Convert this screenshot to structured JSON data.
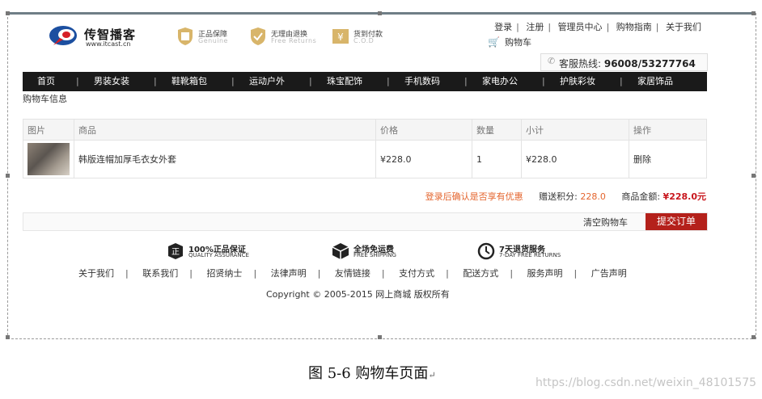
{
  "header": {
    "logo_name": "传智播客",
    "logo_url": "www.itcast.cn",
    "badges": [
      {
        "title": "正品保障",
        "subtitle": "Genuine"
      },
      {
        "title": "无理由退换",
        "subtitle": "Free Returns"
      },
      {
        "title": "货到付款",
        "subtitle": "C.O.D"
      }
    ],
    "top_links": [
      "登录",
      "注册",
      "管理员中心",
      "购物指南",
      "关于我们"
    ],
    "cart_label": "购物车",
    "hotline_label": "客服热线: ",
    "hotline_number": "96008/53277764"
  },
  "nav": {
    "items": [
      "首页",
      "男装女装",
      "鞋靴箱包",
      "运动户外",
      "珠宝配饰",
      "手机数码",
      "家电办公",
      "护肤彩妆",
      "家居饰品"
    ]
  },
  "cart": {
    "section_title": "购物车信息",
    "columns": [
      "图片",
      "商品",
      "价格",
      "数量",
      "小计",
      "操作"
    ],
    "rows": [
      {
        "name": "韩版连帽加厚毛衣女外套",
        "price": "¥228.0",
        "quantity": "1",
        "subtotal": "¥228.0",
        "action": "删除"
      }
    ],
    "promo_text": "登录后确认是否享有优惠",
    "points_label": "赠送积分: ",
    "points_value": "228.0",
    "amount_label": "商品金额: ",
    "amount_value": "¥228.0元",
    "clear_label": "清空购物车",
    "submit_label": "提交订单"
  },
  "footer": {
    "guarantees": [
      {
        "title": "100%正品保证",
        "subtitle": "QUALITY ASSURANCE",
        "icon": "quality-icon"
      },
      {
        "title": "全场免运费",
        "subtitle": "FREE SHIPPING",
        "icon": "box-icon"
      },
      {
        "title": "7天退货服务",
        "subtitle": "7-DAY FREE RETURNS",
        "icon": "clock-icon"
      }
    ],
    "links": [
      "关于我们",
      "联系我们",
      "招贤纳士",
      "法律声明",
      "友情链接",
      "支付方式",
      "配送方式",
      "服务声明",
      "广告声明"
    ],
    "copyright": "Copyright © 2005-2015 网上商城 版权所有"
  },
  "caption": {
    "text": "图  5-6 购物车页面",
    "mark": "↵"
  },
  "watermark": "https://blog.csdn.net/weixin_48101575",
  "colors": {
    "nav_bg": "#1a1a1a",
    "accent_red": "#c8161d",
    "submit_bg": "#b4211b",
    "promo_orange": "#e4652e"
  }
}
